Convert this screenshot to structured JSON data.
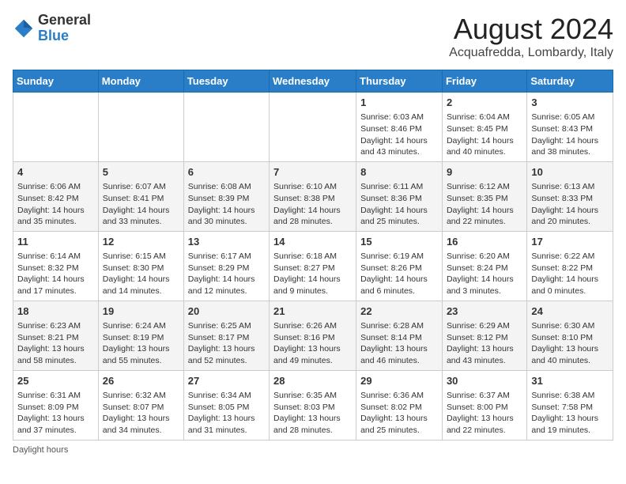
{
  "header": {
    "logo_general": "General",
    "logo_blue": "Blue",
    "title": "August 2024",
    "location": "Acquafredda, Lombardy, Italy"
  },
  "days_of_week": [
    "Sunday",
    "Monday",
    "Tuesday",
    "Wednesday",
    "Thursday",
    "Friday",
    "Saturday"
  ],
  "weeks": [
    [
      {
        "day": "",
        "info": ""
      },
      {
        "day": "",
        "info": ""
      },
      {
        "day": "",
        "info": ""
      },
      {
        "day": "",
        "info": ""
      },
      {
        "day": "1",
        "info": "Sunrise: 6:03 AM\nSunset: 8:46 PM\nDaylight: 14 hours and 43 minutes."
      },
      {
        "day": "2",
        "info": "Sunrise: 6:04 AM\nSunset: 8:45 PM\nDaylight: 14 hours and 40 minutes."
      },
      {
        "day": "3",
        "info": "Sunrise: 6:05 AM\nSunset: 8:43 PM\nDaylight: 14 hours and 38 minutes."
      }
    ],
    [
      {
        "day": "4",
        "info": "Sunrise: 6:06 AM\nSunset: 8:42 PM\nDaylight: 14 hours and 35 minutes."
      },
      {
        "day": "5",
        "info": "Sunrise: 6:07 AM\nSunset: 8:41 PM\nDaylight: 14 hours and 33 minutes."
      },
      {
        "day": "6",
        "info": "Sunrise: 6:08 AM\nSunset: 8:39 PM\nDaylight: 14 hours and 30 minutes."
      },
      {
        "day": "7",
        "info": "Sunrise: 6:10 AM\nSunset: 8:38 PM\nDaylight: 14 hours and 28 minutes."
      },
      {
        "day": "8",
        "info": "Sunrise: 6:11 AM\nSunset: 8:36 PM\nDaylight: 14 hours and 25 minutes."
      },
      {
        "day": "9",
        "info": "Sunrise: 6:12 AM\nSunset: 8:35 PM\nDaylight: 14 hours and 22 minutes."
      },
      {
        "day": "10",
        "info": "Sunrise: 6:13 AM\nSunset: 8:33 PM\nDaylight: 14 hours and 20 minutes."
      }
    ],
    [
      {
        "day": "11",
        "info": "Sunrise: 6:14 AM\nSunset: 8:32 PM\nDaylight: 14 hours and 17 minutes."
      },
      {
        "day": "12",
        "info": "Sunrise: 6:15 AM\nSunset: 8:30 PM\nDaylight: 14 hours and 14 minutes."
      },
      {
        "day": "13",
        "info": "Sunrise: 6:17 AM\nSunset: 8:29 PM\nDaylight: 14 hours and 12 minutes."
      },
      {
        "day": "14",
        "info": "Sunrise: 6:18 AM\nSunset: 8:27 PM\nDaylight: 14 hours and 9 minutes."
      },
      {
        "day": "15",
        "info": "Sunrise: 6:19 AM\nSunset: 8:26 PM\nDaylight: 14 hours and 6 minutes."
      },
      {
        "day": "16",
        "info": "Sunrise: 6:20 AM\nSunset: 8:24 PM\nDaylight: 14 hours and 3 minutes."
      },
      {
        "day": "17",
        "info": "Sunrise: 6:22 AM\nSunset: 8:22 PM\nDaylight: 14 hours and 0 minutes."
      }
    ],
    [
      {
        "day": "18",
        "info": "Sunrise: 6:23 AM\nSunset: 8:21 PM\nDaylight: 13 hours and 58 minutes."
      },
      {
        "day": "19",
        "info": "Sunrise: 6:24 AM\nSunset: 8:19 PM\nDaylight: 13 hours and 55 minutes."
      },
      {
        "day": "20",
        "info": "Sunrise: 6:25 AM\nSunset: 8:17 PM\nDaylight: 13 hours and 52 minutes."
      },
      {
        "day": "21",
        "info": "Sunrise: 6:26 AM\nSunset: 8:16 PM\nDaylight: 13 hours and 49 minutes."
      },
      {
        "day": "22",
        "info": "Sunrise: 6:28 AM\nSunset: 8:14 PM\nDaylight: 13 hours and 46 minutes."
      },
      {
        "day": "23",
        "info": "Sunrise: 6:29 AM\nSunset: 8:12 PM\nDaylight: 13 hours and 43 minutes."
      },
      {
        "day": "24",
        "info": "Sunrise: 6:30 AM\nSunset: 8:10 PM\nDaylight: 13 hours and 40 minutes."
      }
    ],
    [
      {
        "day": "25",
        "info": "Sunrise: 6:31 AM\nSunset: 8:09 PM\nDaylight: 13 hours and 37 minutes."
      },
      {
        "day": "26",
        "info": "Sunrise: 6:32 AM\nSunset: 8:07 PM\nDaylight: 13 hours and 34 minutes."
      },
      {
        "day": "27",
        "info": "Sunrise: 6:34 AM\nSunset: 8:05 PM\nDaylight: 13 hours and 31 minutes."
      },
      {
        "day": "28",
        "info": "Sunrise: 6:35 AM\nSunset: 8:03 PM\nDaylight: 13 hours and 28 minutes."
      },
      {
        "day": "29",
        "info": "Sunrise: 6:36 AM\nSunset: 8:02 PM\nDaylight: 13 hours and 25 minutes."
      },
      {
        "day": "30",
        "info": "Sunrise: 6:37 AM\nSunset: 8:00 PM\nDaylight: 13 hours and 22 minutes."
      },
      {
        "day": "31",
        "info": "Sunrise: 6:38 AM\nSunset: 7:58 PM\nDaylight: 13 hours and 19 minutes."
      }
    ]
  ],
  "footer": {
    "note": "Daylight hours"
  }
}
